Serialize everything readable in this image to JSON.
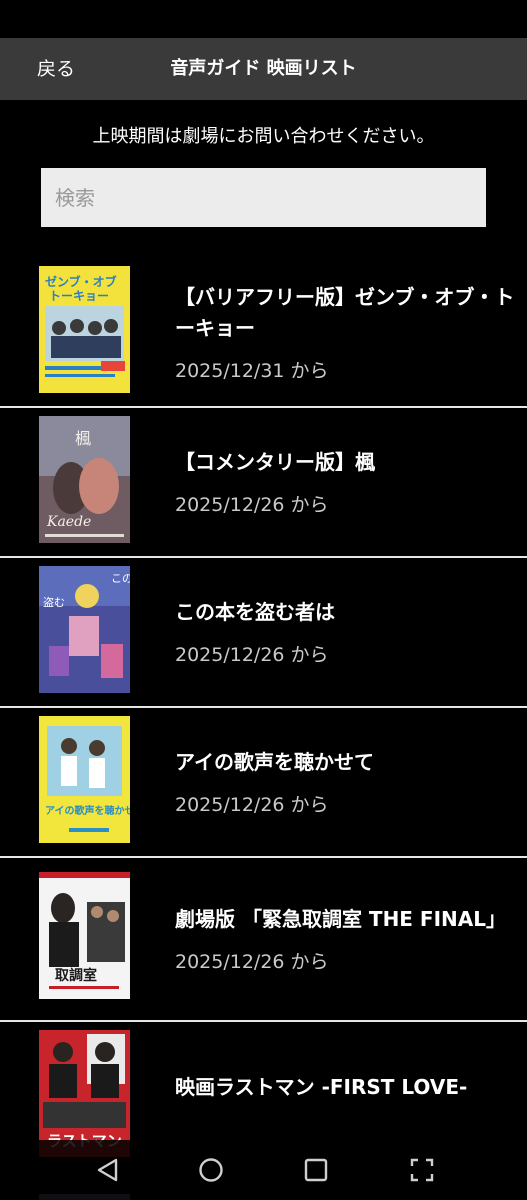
{
  "header": {
    "back_label": "戻る",
    "title": "音声ガイド 映画リスト"
  },
  "notice": "上映期間は劇場にお問い合わせください。",
  "search": {
    "placeholder": "検索",
    "value": ""
  },
  "movies": [
    {
      "title": "【バリアフリー版】ゼンブ・オブ・トーキョー",
      "date": "2025/12/31 から",
      "poster_colors": [
        "#f3e23b",
        "#3aa4d9",
        "#ffffff"
      ]
    },
    {
      "title": "【コメンタリー版】楓",
      "date": "2025/12/26 から",
      "poster_colors": [
        "#8c8aa0",
        "#c97a6a",
        "#e8d8cf"
      ]
    },
    {
      "title": "この本を盗む者は",
      "date": "2025/12/26 から",
      "poster_colors": [
        "#6b5aa8",
        "#e2c04c",
        "#3b3f7a"
      ]
    },
    {
      "title": "アイの歌声を聴かせて",
      "date": "2025/12/26 から",
      "poster_colors": [
        "#f0e33a",
        "#5ab6d7",
        "#ffffff"
      ]
    },
    {
      "title": "劇場版 「緊急取調室 THE FINAL」",
      "date": "2025/12/26 から",
      "poster_colors": [
        "#ffffff",
        "#1b1b1b",
        "#c71f2a"
      ]
    },
    {
      "title": "映画ラストマン -FIRST LOVE-",
      "date": "",
      "poster_colors": [
        "#c8242b",
        "#1a1a1a",
        "#f2f2f2"
      ]
    }
  ],
  "nav": {
    "back_icon": "triangle-back-icon",
    "home_icon": "circle-home-icon",
    "recents_icon": "square-recents-icon",
    "screenshot_icon": "corners-screenshot-icon"
  }
}
